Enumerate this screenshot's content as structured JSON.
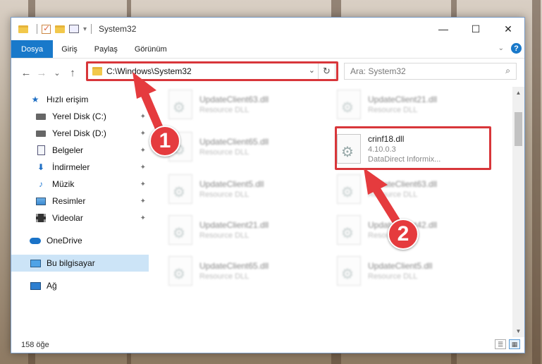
{
  "window": {
    "title": "System32",
    "controls": {
      "minimize": "—",
      "maximize": "☐",
      "close": "✕"
    }
  },
  "ribbon": {
    "tabs": [
      "Dosya",
      "Giriş",
      "Paylaş",
      "Görünüm"
    ],
    "active_tab": "Dosya",
    "help": "?"
  },
  "nav": {
    "back": "←",
    "forward": "→",
    "recent": "⌄",
    "up": "↑",
    "address": "C:\\Windows\\System32",
    "refresh": "↻",
    "dropdown": "⌄",
    "search_placeholder": "Ara: System32",
    "search_icon": "🔍"
  },
  "sidebar": {
    "items": [
      {
        "label": "Hızlı erişim",
        "icon": "star-icon",
        "pinned": false
      },
      {
        "label": "Yerel Disk (C:)",
        "icon": "drive-icon",
        "pinned": true
      },
      {
        "label": "Yerel Disk (D:)",
        "icon": "drive-icon",
        "pinned": true
      },
      {
        "label": "Belgeler",
        "icon": "document-icon",
        "pinned": true
      },
      {
        "label": "İndirmeler",
        "icon": "download-icon",
        "pinned": true
      },
      {
        "label": "Müzik",
        "icon": "music-icon",
        "pinned": true
      },
      {
        "label": "Resimler",
        "icon": "pictures-icon",
        "pinned": true
      },
      {
        "label": "Videolar",
        "icon": "videos-icon",
        "pinned": true
      },
      {
        "label": "OneDrive",
        "icon": "onedrive-icon",
        "pinned": false
      },
      {
        "label": "Bu bilgisayar",
        "icon": "this-pc-icon",
        "pinned": false,
        "selected": true
      },
      {
        "label": "Ağ",
        "icon": "network-icon",
        "pinned": false
      }
    ],
    "pin_glyph": "📌"
  },
  "files": [
    {
      "name": "UpdateClient63.dll",
      "type": "Resource DLL"
    },
    {
      "name": "UpdateClient21.dll",
      "type": "Resource DLL"
    },
    {
      "name": "UpdateClient65.dll",
      "type": "Resource DLL"
    },
    {
      "name": "crinf18.dll",
      "version": "4.10.0.3",
      "company": "DataDirect Informix...",
      "highlighted": true
    },
    {
      "name": "UpdateClient5.dll",
      "type": "Resource DLL"
    },
    {
      "name": "UpdateClient63.dll",
      "type": "Resource DLL"
    },
    {
      "name": "UpdateClient21.dll",
      "type": "Resource DLL"
    },
    {
      "name": "UpdateClient42.dll",
      "type": "Resource DLL"
    },
    {
      "name": "UpdateClient65.dll",
      "type": "Resource DLL"
    },
    {
      "name": "UpdateClient5.dll",
      "type": "Resource DLL"
    }
  ],
  "status": {
    "item_count": "158 öğe"
  },
  "annotations": {
    "step1": "1",
    "step2": "2",
    "color": "#e53b3e"
  }
}
